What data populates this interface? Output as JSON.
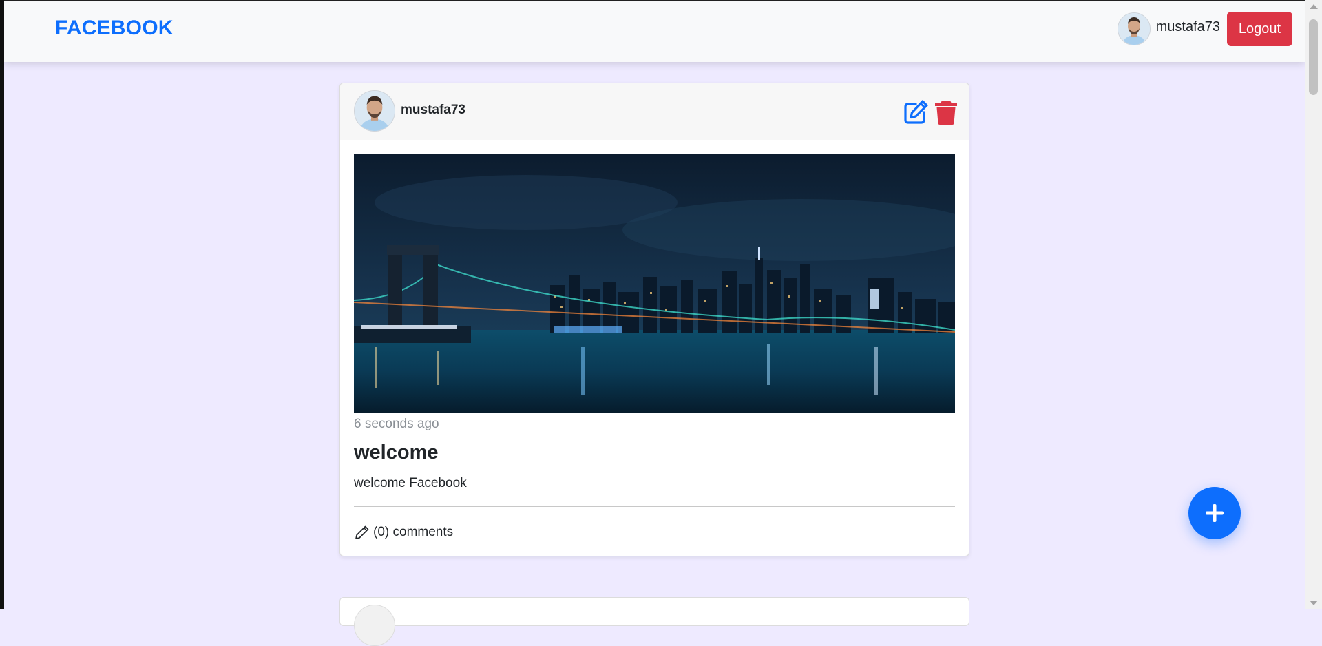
{
  "navbar": {
    "brand": "FACEBOOK",
    "username": "mustafa73",
    "logout_label": "Logout",
    "avatar_icon": "user-avatar"
  },
  "post": {
    "author": "mustafa73",
    "time_ago": "6 seconds ago",
    "title": "welcome",
    "body": "welcome Facebook",
    "comments_label": "(0) comments",
    "image_subject": "city-skyline-at-night",
    "edit_icon": "edit-icon",
    "delete_icon": "trash-icon",
    "comment_icon": "pencil-icon"
  },
  "fab": {
    "icon": "plus-icon"
  },
  "colors": {
    "primary": "#0d6efd",
    "danger": "#dc3545",
    "page_background": "#eeeaff",
    "navbar_background": "#f8f9fa"
  }
}
